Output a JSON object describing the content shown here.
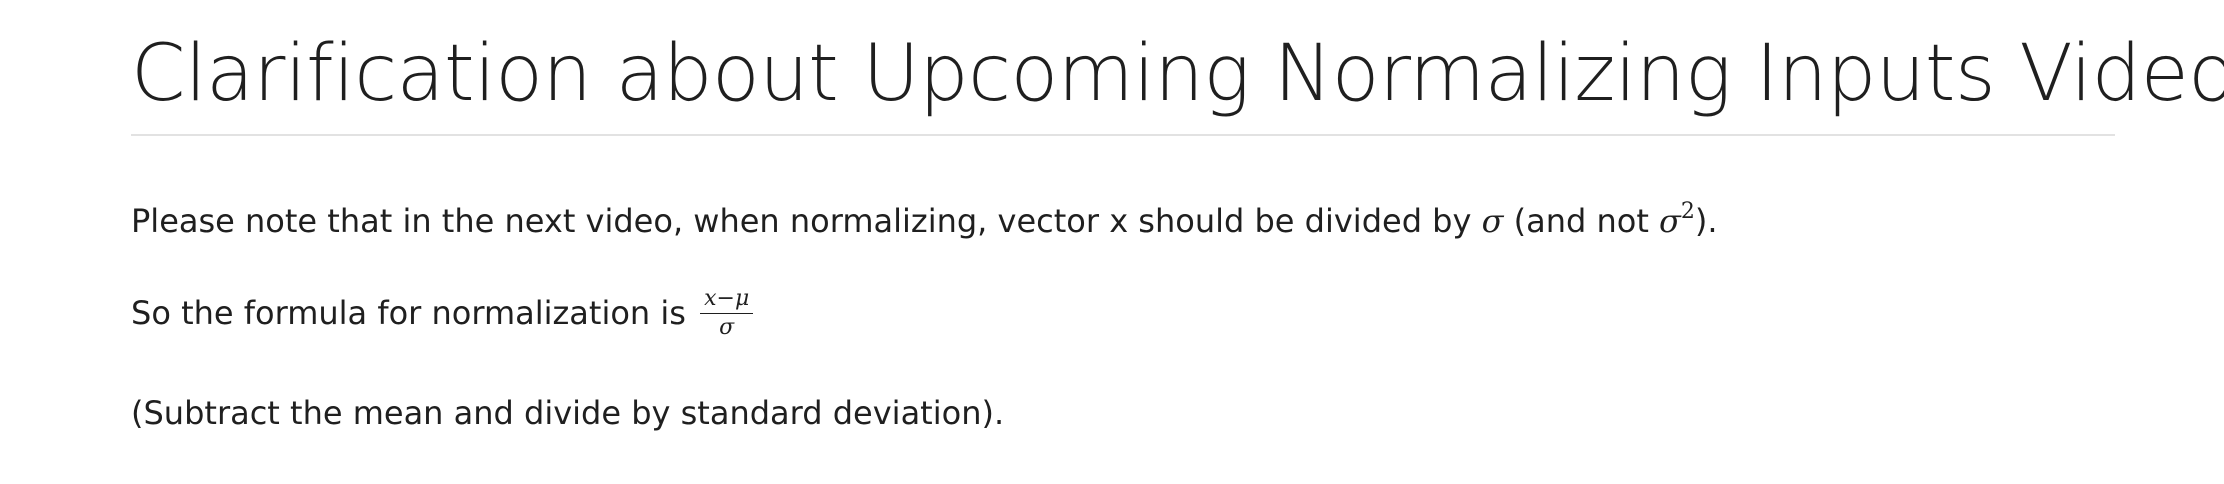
{
  "header": {
    "title": "Clarification about Upcoming Normalizing Inputs Video"
  },
  "content": {
    "paragraph1": {
      "text_before": "Please note that in the next video, when normalizing, vector x should be divided by ",
      "sigma": "σ",
      "text_middle": " (and not ",
      "sigma2": "σ",
      "exponent": "2",
      "text_after": ")."
    },
    "paragraph2": {
      "text_before": "So the formula for normalization is ",
      "formula_numerator": "x−μ",
      "formula_denominator": "σ"
    },
    "paragraph3": {
      "text": "(Subtract the mean and divide by standard deviation)."
    }
  }
}
